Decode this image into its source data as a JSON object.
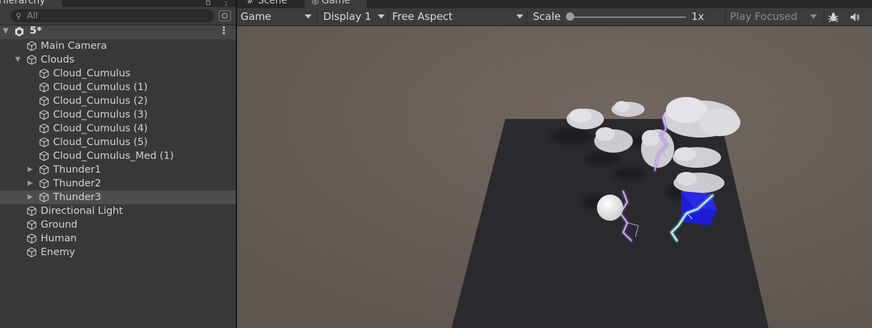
{
  "hierarchy": {
    "tab_label": "Hierarchy",
    "search_placeholder": "All",
    "scene": {
      "name": "5*"
    },
    "items": [
      {
        "label": "Main Camera",
        "indent": 0,
        "expandable": false
      },
      {
        "label": "Clouds",
        "indent": 0,
        "expandable": true,
        "expanded": true
      },
      {
        "label": "Cloud_Cumulus",
        "indent": 1,
        "expandable": false
      },
      {
        "label": "Cloud_Cumulus (1)",
        "indent": 1,
        "expandable": false
      },
      {
        "label": "Cloud_Cumulus (2)",
        "indent": 1,
        "expandable": false
      },
      {
        "label": "Cloud_Cumulus (3)",
        "indent": 1,
        "expandable": false
      },
      {
        "label": "Cloud_Cumulus (4)",
        "indent": 1,
        "expandable": false
      },
      {
        "label": "Cloud_Cumulus (5)",
        "indent": 1,
        "expandable": false
      },
      {
        "label": "Cloud_Cumulus_Med (1)",
        "indent": 1,
        "expandable": false
      },
      {
        "label": "Thunder1",
        "indent": 1,
        "expandable": true,
        "expanded": false
      },
      {
        "label": "Thunder2",
        "indent": 1,
        "expandable": true,
        "expanded": false
      },
      {
        "label": "Thunder3",
        "indent": 1,
        "expandable": true,
        "expanded": false,
        "selected": true
      },
      {
        "label": "Directional Light",
        "indent": 0,
        "expandable": false
      },
      {
        "label": "Ground",
        "indent": 0,
        "expandable": false
      },
      {
        "label": "Human",
        "indent": 0,
        "expandable": false
      },
      {
        "label": "Enemy",
        "indent": 0,
        "expandable": false
      }
    ]
  },
  "game_view": {
    "tabs": {
      "scene": "Scene",
      "game": "Game"
    },
    "toolbar": {
      "view_mode": "Game",
      "display": "Display 1",
      "aspect": "Free Aspect",
      "scale_label": "Scale",
      "scale_value": "1x",
      "scale_level": 0,
      "play_mode": "Play Focused"
    },
    "icons": {
      "stats": "bug-icon",
      "audio": "speaker-icon"
    },
    "colors": {
      "sky": "#6a6058",
      "ground": "#2a2a2e",
      "enemy_cube": "#1e1ed8",
      "lightning": "#b98be8"
    }
  }
}
